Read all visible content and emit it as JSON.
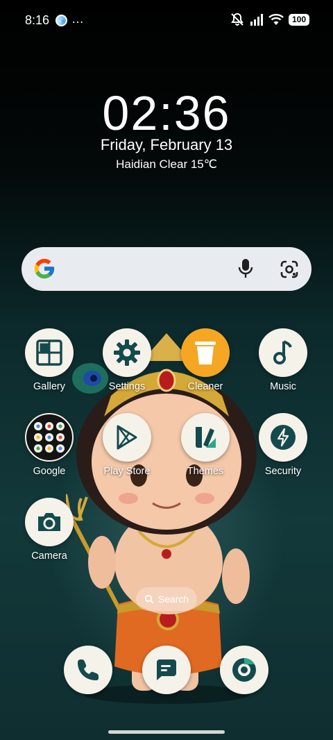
{
  "status_bar": {
    "time": "8:16",
    "more": "…",
    "battery": "100",
    "icons": [
      "app-notification-icon",
      "silent-icon",
      "signal-icon",
      "wifi-icon",
      "battery-icon"
    ]
  },
  "clock_widget": {
    "time": "02:36",
    "date": "Friday,  February  13",
    "weather": "Haidian Clear 15℃"
  },
  "google_search": {
    "icons": [
      "google-logo-icon",
      "microphone-icon",
      "google-lens-icon"
    ]
  },
  "apps": [
    {
      "label": "Gallery",
      "icon": "gallery-icon"
    },
    {
      "label": "Settings",
      "icon": "gear-icon"
    },
    {
      "label": "Cleaner",
      "icon": "trash-icon"
    },
    {
      "label": "Music",
      "icon": "music-note-icon"
    },
    {
      "label": "Google",
      "icon": "google-folder-icon"
    },
    {
      "label": "Play Store",
      "icon": "play-store-icon"
    },
    {
      "label": "Themes",
      "icon": "themes-icon"
    },
    {
      "label": "Security",
      "icon": "shield-bolt-icon"
    },
    {
      "label": "Camera",
      "icon": "camera-icon"
    }
  ],
  "app_search": {
    "label": "Search"
  },
  "dock": [
    {
      "icon": "phone-icon"
    },
    {
      "icon": "messages-icon"
    },
    {
      "icon": "browser-icon"
    }
  ],
  "colors": {
    "app_icon_bg": "#f5f2ea",
    "icon_teal": "#144a4d",
    "cleaner_orange": "#f5a623"
  }
}
